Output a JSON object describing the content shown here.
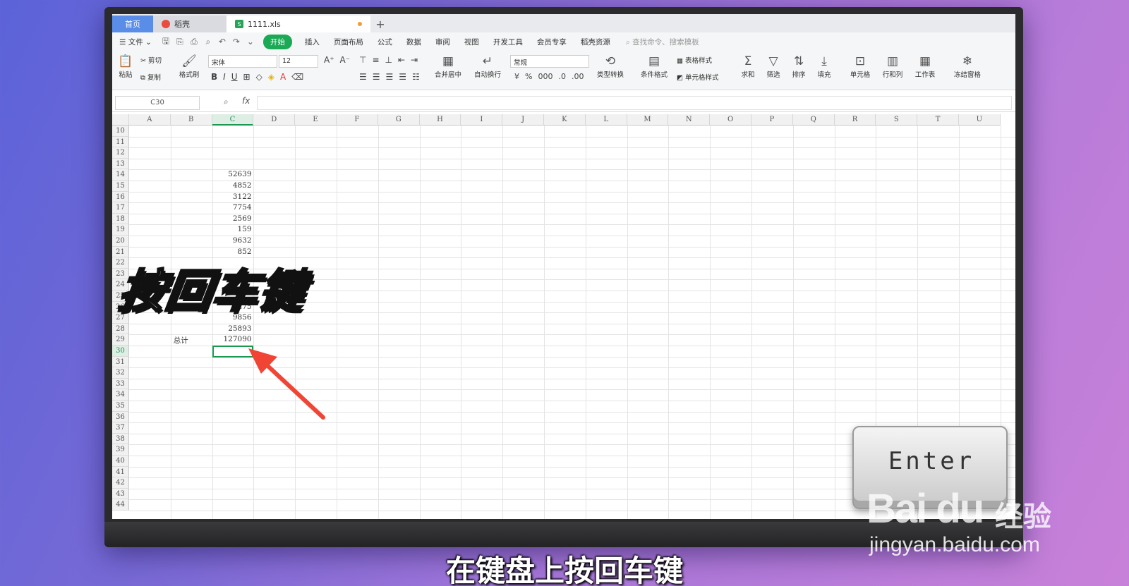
{
  "tabs": {
    "home": "首页",
    "daoke": "稻壳",
    "file": "1111.xls",
    "new_tab": "+"
  },
  "menu": {
    "file": "文件",
    "items": [
      "开始",
      "插入",
      "页面布局",
      "公式",
      "数据",
      "审阅",
      "视图",
      "开发工具",
      "会员专享",
      "稻壳资源"
    ],
    "search_placeholder": "查找命令、搜索模板"
  },
  "ribbon": {
    "paste": "粘贴",
    "cut": "剪切",
    "copy": "复制",
    "format_painter": "格式刷",
    "font_name": "宋体",
    "font_size": "12",
    "merge_center": "合并居中",
    "wrap_text": "自动换行",
    "number_format": "常规",
    "type_convert": "类型转换",
    "conditional_format": "条件格式",
    "table_style": "表格样式",
    "cell_style": "单元格样式",
    "sum": "求和",
    "filter": "筛选",
    "sort": "排序",
    "fill": "填充",
    "cell": "单元格",
    "row_col": "行和列",
    "worksheet": "工作表",
    "freeze": "冻结窗格"
  },
  "formula_bar": {
    "name_box": "C30",
    "fx": "fx",
    "value": ""
  },
  "sheet": {
    "columns": [
      "A",
      "B",
      "C",
      "D",
      "E",
      "F",
      "G",
      "H",
      "I",
      "J",
      "K",
      "L",
      "M",
      "N",
      "O",
      "P",
      "Q",
      "R",
      "S",
      "T",
      "U"
    ],
    "selected_column": "C",
    "rows": [
      "10",
      "11",
      "12",
      "13",
      "14",
      "15",
      "16",
      "17",
      "18",
      "19",
      "20",
      "21",
      "22",
      "23",
      "24",
      "25",
      "26",
      "27",
      "28",
      "29",
      "30",
      "31",
      "32",
      "33",
      "34",
      "35",
      "36",
      "37",
      "38",
      "39",
      "40",
      "41",
      "42",
      "43",
      "44"
    ],
    "selected_row": "30",
    "c_values": [
      {
        "row": "14",
        "value": "52639"
      },
      {
        "row": "15",
        "value": "4852"
      },
      {
        "row": "16",
        "value": "3122"
      },
      {
        "row": "17",
        "value": "7754"
      },
      {
        "row": "18",
        "value": "2569"
      },
      {
        "row": "19",
        "value": "159"
      },
      {
        "row": "20",
        "value": "9632"
      },
      {
        "row": "21",
        "value": "852"
      },
      {
        "row": "26",
        "value": "1475"
      },
      {
        "row": "27",
        "value": "9856"
      },
      {
        "row": "28",
        "value": "25893"
      },
      {
        "row": "29",
        "value": "127090"
      }
    ],
    "total_label": "总计"
  },
  "overlay": {
    "headline": "按回车键",
    "enter_key": "Enter",
    "watermark_logo": "Bai du",
    "watermark_jingyan": "经验",
    "watermark_url": "jingyan.baidu.com",
    "subtitle": "在键盘上按回车键",
    "arrow_color": "#f04535"
  },
  "colors": {
    "accent_green": "#1aaa55",
    "tab_blue": "#5a8de8",
    "selection": "#1a9850"
  }
}
